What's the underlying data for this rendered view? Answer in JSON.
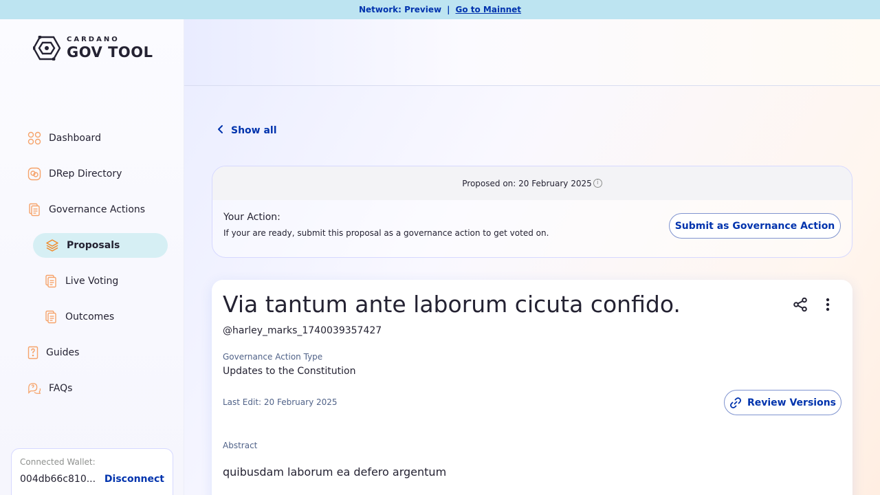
{
  "banner": {
    "network_text": "Network: Preview",
    "separator": "|",
    "mainnet_link": "Go to Mainnet"
  },
  "logo": {
    "small": "CARDANO",
    "big": "GOV TOOL"
  },
  "sidebar": {
    "items": [
      {
        "label": "Dashboard",
        "icon": "dashboard-icon"
      },
      {
        "label": "DRep Directory",
        "icon": "drep-directory-icon"
      },
      {
        "label": "Governance Actions",
        "icon": "governance-actions-icon"
      },
      {
        "label": "Proposals",
        "icon": "proposals-icon",
        "active": true
      },
      {
        "label": "Live Voting",
        "icon": "live-voting-icon"
      },
      {
        "label": "Outcomes",
        "icon": "outcomes-icon"
      },
      {
        "label": "Guides",
        "icon": "guides-icon"
      },
      {
        "label": "FAQs",
        "icon": "faqs-icon"
      }
    ]
  },
  "wallet": {
    "label": "Connected Wallet:",
    "address": "004db66c810...",
    "disconnect": "Disconnect"
  },
  "back_link": "Show all",
  "action_card": {
    "proposed_on": "Proposed on: 20 February 2025",
    "title": "Your Action:",
    "description": "If your are ready, submit this proposal as a governance action to get voted on.",
    "submit_button": "Submit as Governance Action"
  },
  "proposal": {
    "title": "Via tantum ante laborum cicuta confido.",
    "author": "@harley_marks_1740039357427",
    "type_label": "Governance Action Type",
    "type_value": "Updates to the Constitution",
    "last_edit": "Last Edit: 20 February 2025",
    "review_button": "Review Versions",
    "abstract_label": "Abstract",
    "abstract_value": "quibusdam laborum ea defero argentum"
  },
  "colors": {
    "brand_blue": "#0033ad",
    "banner_bg": "#bde4f1",
    "active_nav_bg": "#d6eff4",
    "icon_orange": "#f6a36a"
  }
}
